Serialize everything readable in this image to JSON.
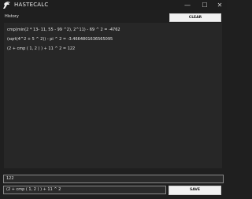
{
  "window": {
    "title": "HASTECALC",
    "minimize": "—",
    "maximize": "☐",
    "close": "✕",
    "icon": "eagle-logo-icon"
  },
  "history": {
    "label": "History",
    "clear_label": "CLEAR",
    "items": [
      "cmp(min(2 * 13- 11, 55 - 99 ^2), 2^11) - 69 ^ 2 = -4762",
      "(sqrt(4^2 + 5 ^ 2)) - pi ^ 2 = -3.4664801636565095",
      "(2 + cmp ( 1, 2 ) ) + 11 ^ 2 = 122"
    ]
  },
  "result": {
    "value": "122"
  },
  "expression": {
    "value": "(2 + cmp ( 1, 2 ) ) + 11 ^ 2"
  },
  "save_label": "SAVE"
}
